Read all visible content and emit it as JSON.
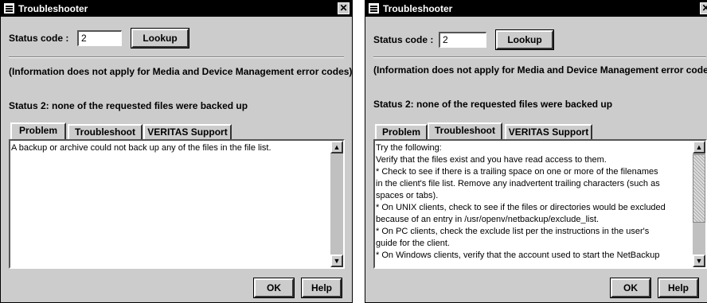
{
  "windows": [
    {
      "title": "Troubleshooter",
      "close_glyph": "✕",
      "status_label": "Status code :",
      "status_value": "2",
      "lookup_label": "Lookup",
      "info_note": "(Information does not apply for Media and Device Management error codes)",
      "status_message": "Status 2: none of the requested files were backed up",
      "tabs": [
        {
          "label": "Problem",
          "active": true
        },
        {
          "label": "Troubleshoot",
          "active": false
        },
        {
          "label": "VERITAS Support",
          "active": false
        }
      ],
      "panel_text": "A backup or archive could not back up any of the files in the file list.",
      "ok_label": "OK",
      "help_label": "Help",
      "scroll_position": 0
    },
    {
      "title": "Troubleshooter",
      "close_glyph": "✕",
      "status_label": "Status code :",
      "status_value": "2",
      "lookup_label": "Lookup",
      "info_note": "(Information does not apply for Media and Device Management error codes)",
      "status_message": "Status 2: none of the requested files were backed up",
      "tabs": [
        {
          "label": "Problem",
          "active": false
        },
        {
          "label": "Troubleshoot",
          "active": true
        },
        {
          "label": "VERITAS Support",
          "active": false
        }
      ],
      "panel_text": "Try the following:\nVerify that the files exist and you have read access to them.\n*  Check to see if there is a trailing space on one or more of the filenames\nin the client's file list. Remove any inadvertent trailing characters (such as\nspaces or tabs).\n*  On UNIX clients, check to see if the files or directories would be excluded\nbecause of an entry in /usr/openv/netbackup/exclude_list.\n*  On PC clients, check the exclude list per the instructions in the user's\nguide for the client.\n*  On Windows clients, verify that the account used to start the NetBackup",
      "ok_label": "OK",
      "help_label": "Help",
      "scroll_position": 0
    }
  ],
  "icons": {
    "app": "window-app-icon",
    "close": "close-icon",
    "scroll_up": "arrow-up-icon",
    "scroll_down": "arrow-down-icon",
    "scroll_up_glyph": "▲",
    "scroll_down_glyph": "▼"
  }
}
